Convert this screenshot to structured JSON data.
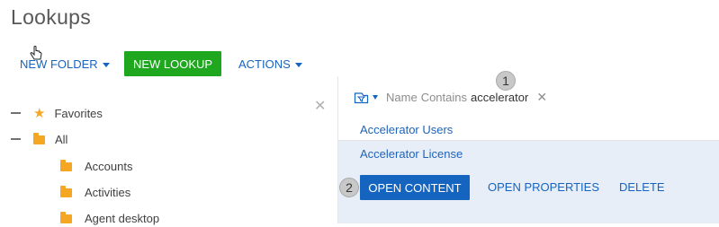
{
  "page": {
    "title": "Lookups"
  },
  "toolbar": {
    "new_folder": "NEW FOLDER",
    "new_lookup": "NEW LOOKUP",
    "actions": "ACTIONS"
  },
  "tree": {
    "favorites": "Favorites",
    "all": "All",
    "folders": [
      "Accounts",
      "Activities",
      "Agent desktop"
    ]
  },
  "filter": {
    "field": "Name",
    "operator": "Contains",
    "value": "accelerator",
    "clear": "×"
  },
  "results": {
    "rows": [
      "Accelerator Users",
      "Accelerator License"
    ]
  },
  "row_actions": {
    "open_content": "OPEN CONTENT",
    "open_properties": "OPEN PROPERTIES",
    "delete": "DELETE"
  },
  "callouts": [
    "1",
    "2"
  ],
  "colors": {
    "accent": "#1565c0",
    "green": "#20a720",
    "star": "#f5a623",
    "selected_row": "#e8eef8"
  },
  "icons": [
    "hand-cursor-icon",
    "close-icon",
    "star-icon",
    "folder-icon",
    "filter-icon"
  ]
}
